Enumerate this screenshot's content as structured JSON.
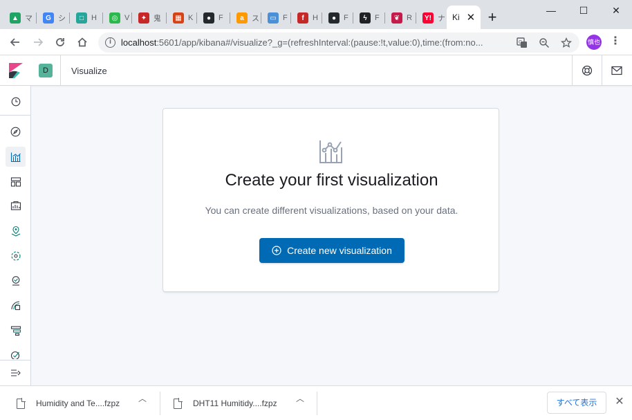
{
  "browser": {
    "tabs": [
      {
        "favicon": "google-drive-icon",
        "title": "マ",
        "color": "#1fa463",
        "glyph": "▲"
      },
      {
        "favicon": "google-icon",
        "title": "シ",
        "color": "#4285f4",
        "glyph": "G"
      },
      {
        "favicon": "app-icon",
        "title": "H",
        "color": "#26a69a",
        "glyph": "□"
      },
      {
        "favicon": "circle-app-icon",
        "title": "V",
        "color": "#2db84d",
        "glyph": "◎"
      },
      {
        "favicon": "game-icon",
        "title": "鬼",
        "color": "#c62828",
        "glyph": "✦"
      },
      {
        "favicon": "document-icon",
        "title": "K",
        "color": "#d84315",
        "glyph": "▦"
      },
      {
        "favicon": "github-icon",
        "title": "F",
        "color": "#24292e",
        "glyph": "●"
      },
      {
        "favicon": "amazon-icon",
        "title": "ス",
        "color": "#ff9900",
        "glyph": "a"
      },
      {
        "favicon": "monitor-icon",
        "title": "F",
        "color": "#4a90d9",
        "glyph": "▭"
      },
      {
        "favicon": "fritzing-icon",
        "title": "H",
        "color": "#c62828",
        "glyph": "f"
      },
      {
        "favicon": "github-icon",
        "title": "F",
        "color": "#24292e",
        "glyph": "●"
      },
      {
        "favicon": "bolt-icon",
        "title": "F",
        "color": "#202124",
        "glyph": "ϟ"
      },
      {
        "favicon": "raspberry-pi-icon",
        "title": "R",
        "color": "#c51a4a",
        "glyph": "❦"
      },
      {
        "favicon": "yahoo-icon",
        "title": "ナ",
        "color": "#ff0033",
        "glyph": "Y!"
      }
    ],
    "active_tab": {
      "title": "Ki",
      "close": "✕"
    },
    "new_tab": "+",
    "window": {
      "minimize": "—",
      "maximize": "☐",
      "close": "✕"
    },
    "url_host": "localhost",
    "url_rest": ":5601/app/kibana#/visualize?_g=(refreshInterval:(pause:!t,value:0),time:(from:no...",
    "avatar_text": "慎也"
  },
  "kibana": {
    "space_initial": "D",
    "breadcrumb": "Visualize",
    "empty_prompt": {
      "title": "Create your first visualization",
      "description": "You can create different visualizations, based on your data.",
      "button_label": "Create new visualization"
    }
  },
  "downloads": {
    "items": [
      {
        "name": "Humidity and Te....fzpz"
      },
      {
        "name": "DHT11 Humitidy....fzpz"
      }
    ],
    "show_all": "すべて表示",
    "close": "✕"
  },
  "colors": {
    "primary": "#006bb4",
    "kibana_logo_pink": "#e8478b",
    "kibana_logo_teal": "#3ebeb0",
    "space_badge": "#54b399"
  }
}
